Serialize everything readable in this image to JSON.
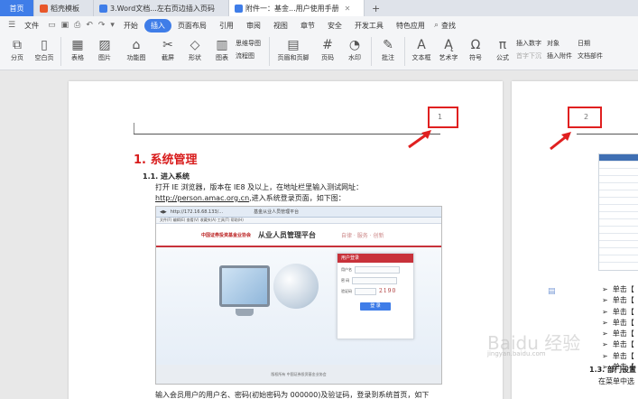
{
  "tabs": [
    {
      "label": "首页"
    },
    {
      "label": "稻壳模板"
    },
    {
      "label": "3.Word文档...左右页边插入页码"
    },
    {
      "label": "附件一：基金...用户使用手册"
    }
  ],
  "menu": {
    "file": "文件",
    "items": [
      "开始",
      "插入",
      "页面布局",
      "引用",
      "审阅",
      "视图",
      "章节",
      "安全",
      "开发工具",
      "特色应用"
    ],
    "search": "查找"
  },
  "ribbon": {
    "buttons": [
      "分页",
      "空白页",
      "表格",
      "图片",
      "功能图",
      "截屏",
      "形状",
      "图表",
      "页眉和页脚",
      "页码",
      "水印",
      "批注",
      "文本框",
      "艺术字",
      "符号",
      "公式"
    ],
    "small": {
      "smartart": "思维导图",
      "flowchart": "流程图",
      "insert_number": "插入数字",
      "object": "对象",
      "first_drop": "首字下沉",
      "attachment": "插入附件",
      "date": "日期",
      "doc_parts": "文档部件"
    }
  },
  "page1": {
    "page_number": "1",
    "heading1": "1.  系统管理",
    "heading2": "1.1.   进入系统",
    "para1": "打开 IE 浏览器，版本在 IE8 及以上，在地址栏里输入测试网址：",
    "url": "http://person.amac.org.cn",
    "url_suffix": ",进入系统登录页面，如下图：",
    "para2": "输入会员用户的用户名、密码(初始密码为 000000)及验证码，登录到系统首页，如下",
    "para3": "图："
  },
  "screenshot": {
    "address": "http://172.16.68.133/...",
    "tab_title": "基金从业人员管理平台",
    "menu_line": "文件(F)  编辑(E)  查看(V)  收藏夹(A)  工具(T)  帮助(H)",
    "org": "中国证券投资基金业协会",
    "platform": "从业人员管理平台",
    "slogan": "自律 · 服务 · 创新",
    "login_title": "用户登录",
    "user_label": "用户名",
    "pass_label": "密 码",
    "captcha_label": "验证码",
    "captcha": "2190",
    "login_button": "登 录",
    "footer": "版权所有 中国证券投资基金业协会"
  },
  "page2": {
    "page_number": "2",
    "bullets": [
      "单击【",
      "单击【",
      "单击【",
      "单击【",
      "单击【",
      "单击【",
      "单击【",
      "单击【"
    ],
    "heading": "1.3.   部门设置",
    "body": "在菜单中选"
  },
  "watermark": {
    "text": "Baidu 经验",
    "sub": "jingyan.baidu.com"
  },
  "colors": {
    "accent": "#3f7de8",
    "heading_red": "#d81c1c",
    "highlight_box": "#e02020"
  }
}
